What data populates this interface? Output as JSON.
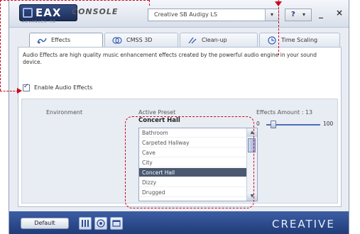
{
  "window": {
    "brand_logo": "EAX",
    "brand_sub": "ADVANCED HD",
    "app_name": "CONSOLE",
    "device": "Creative SB Audigy LS",
    "help_label": "?",
    "minimize_label": "_",
    "close_label": "×"
  },
  "tabs": [
    {
      "label": "Effects",
      "icon": "effects-icon",
      "active": true
    },
    {
      "label": "CMSS 3D",
      "icon": "cmss3d-icon",
      "active": false
    },
    {
      "label": "Clean-up",
      "icon": "cleanup-icon",
      "active": false
    },
    {
      "label": "Time Scaling",
      "icon": "time-scaling-icon",
      "active": false
    }
  ],
  "effects": {
    "description": "Audio Effects are high quality music enhancement effects created by the powerful audio engine in your sound device.",
    "enable_label": "Enable Audio Effects",
    "enable_checked": true,
    "environment_label": "Environment",
    "active_preset_label": "Active Preset",
    "active_preset_value": "Concert Hall",
    "effects_amount_label": "Effects Amount : 13",
    "slider": {
      "min_label": "0",
      "max_label": "100",
      "value": 13
    },
    "presets": [
      "Bathroom",
      "Carpeted Hallway",
      "Cave",
      "City",
      "Concert Hall",
      "Dizzy",
      "Drugged"
    ],
    "selected_preset": "Concert Hall"
  },
  "footer": {
    "default_label": "Default",
    "brand": "CREATIVE"
  },
  "colors": {
    "annotation": "#d0021b",
    "accent": "#2c4a8c",
    "selection": "#4a5870"
  }
}
